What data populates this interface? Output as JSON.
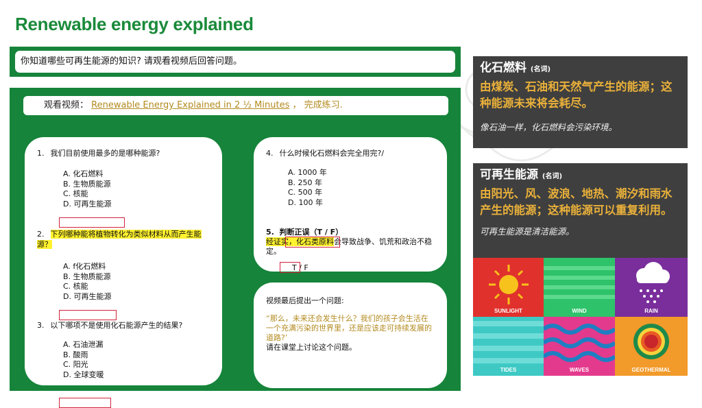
{
  "title": "Renewable energy explained",
  "intro": "你知道哪些可再生能源的知识? 请观看视频后回答问题。",
  "video": {
    "prefix": "观看视频：",
    "link": "Renewable Energy Explained in 2 ½ Minutes",
    "suffix": "，  完成练习."
  },
  "q1": {
    "num": "1.",
    "text": "我们目前使用最多的是哪种能源?",
    "options": [
      "A.  化石燃料",
      "B.  生物质能源",
      "C.  核能",
      "D.  可再生能源"
    ]
  },
  "q2": {
    "num": "2.",
    "text": "下列哪种能将植物转化为类似材料从而产生能源？",
    "options": [
      "A.  f化石燃料",
      "B.  生物质能源",
      "C.  核能",
      "D.  可再生能源"
    ]
  },
  "q3": {
    "num": "3.",
    "text": "以下哪项不是使用化石能源产生的结果?",
    "options": [
      "A.  石油泄漏",
      "B.  酸雨",
      "C.  阳光",
      "D.  全球变暖"
    ]
  },
  "q4": {
    "num": "4.",
    "text": "什么时候化石燃料会完全用完?/",
    "options": [
      "A.  1000 年",
      "B.  250 年",
      "C.  500 年",
      "D.  100 年"
    ]
  },
  "q5": {
    "num": "5.",
    "label": "判断正误（T / F）",
    "highlight": "经证实，化石类原料",
    "rest": "会导致战争、饥荒和政治不稳定。",
    "answer": "T / F"
  },
  "ending": {
    "intro": "视频最后提出一个问题:",
    "quote": "“那么，未来还会发生什么？我们的孩子会生活在一个充满污染的世界里，还是应该走可持续发展的道路?’",
    "instruction": "请在课堂上讨论这个问题。"
  },
  "fossil": {
    "term": "化石燃料",
    "pos": "(名词)",
    "definition": "由煤炭、石油和天然气产生的能源；这种能源未来将会耗尽。",
    "note": "像石油一样，化石燃料会污染环境。"
  },
  "renewable": {
    "term": "可再生能源",
    "pos": "(名词)",
    "definition": "由阳光、风、波浪、地热、潮汐和雨水产生的能源；这种能源可以重复利用。",
    "note": "可再生能源是清洁能源。"
  },
  "tiles": [
    "SUNLIGHT",
    "WIND",
    "RAIN",
    "TIDES",
    "WAVES",
    "GEOTHERMAL"
  ],
  "colors": {
    "green": "#16843a",
    "title_green": "#1a8a3a",
    "gold": "#b38a1e",
    "panel": "#3f3f3f",
    "definition": "#e9b03a",
    "highlight": "#fff22e",
    "answer_box": "#d0223b"
  }
}
